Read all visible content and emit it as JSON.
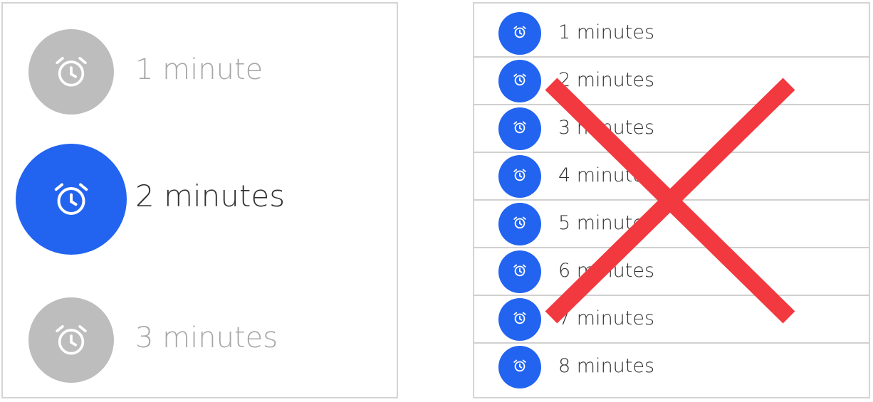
{
  "left_panel": {
    "items": [
      {
        "label": "1 minute",
        "state": "inactive",
        "icon": "alarm-clock-icon"
      },
      {
        "label": "2 minutes",
        "state": "selected",
        "icon": "alarm-clock-icon"
      },
      {
        "label": "3 minutes",
        "state": "inactive",
        "icon": "alarm-clock-icon"
      }
    ]
  },
  "right_panel": {
    "items": [
      {
        "label": "1 minutes",
        "icon": "alarm-clock-icon"
      },
      {
        "label": "2 minutes",
        "icon": "alarm-clock-icon"
      },
      {
        "label": "3 minutes",
        "icon": "alarm-clock-icon"
      },
      {
        "label": "4 minutes",
        "icon": "alarm-clock-icon"
      },
      {
        "label": "5 minutes",
        "icon": "alarm-clock-icon"
      },
      {
        "label": "6 minutes",
        "icon": "alarm-clock-icon"
      },
      {
        "label": "7 minutes",
        "icon": "alarm-clock-icon"
      },
      {
        "label": "8 minutes",
        "icon": "alarm-clock-icon"
      }
    ],
    "overlay": "cross-mark-icon"
  },
  "colors": {
    "accent_blue": "#2264f0",
    "inactive_gray": "#bdbdbd",
    "cross_red": "#f2393f",
    "divider": "#d0d0d0"
  }
}
